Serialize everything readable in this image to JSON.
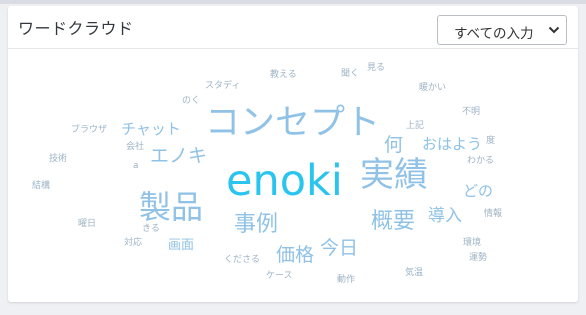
{
  "card": {
    "title": "ワードクラウド",
    "filter": {
      "selected": "すべての入力"
    }
  },
  "colors": {
    "accent": "#29c5ee",
    "large": "#8fc2e6",
    "small": "#9db3c6"
  },
  "word_cloud": [
    {
      "text": "enoki"
    },
    {
      "text": "コンセプト"
    },
    {
      "text": "実績"
    },
    {
      "text": "製品"
    },
    {
      "text": "事例"
    },
    {
      "text": "概要"
    },
    {
      "text": "価格"
    },
    {
      "text": "今日"
    },
    {
      "text": "導入"
    },
    {
      "text": "エノキ"
    },
    {
      "text": "チャット"
    },
    {
      "text": "何"
    },
    {
      "text": "おはよう"
    },
    {
      "text": "どの"
    },
    {
      "text": "画面"
    },
    {
      "text": "スタディ"
    },
    {
      "text": "教える"
    },
    {
      "text": "聞く"
    },
    {
      "text": "見る"
    },
    {
      "text": "暖かい"
    },
    {
      "text": "のく"
    },
    {
      "text": "不明"
    },
    {
      "text": "ブラウザ"
    },
    {
      "text": "上記"
    },
    {
      "text": "度"
    },
    {
      "text": "会社"
    },
    {
      "text": "技術"
    },
    {
      "text": "a"
    },
    {
      "text": "わかる"
    },
    {
      "text": "結構"
    },
    {
      "text": "情報"
    },
    {
      "text": "曜日"
    },
    {
      "text": "きる"
    },
    {
      "text": "対応"
    },
    {
      "text": "環境"
    },
    {
      "text": "くださる"
    },
    {
      "text": "運勢"
    },
    {
      "text": "気温"
    },
    {
      "text": "ケース"
    },
    {
      "text": "動作"
    }
  ]
}
